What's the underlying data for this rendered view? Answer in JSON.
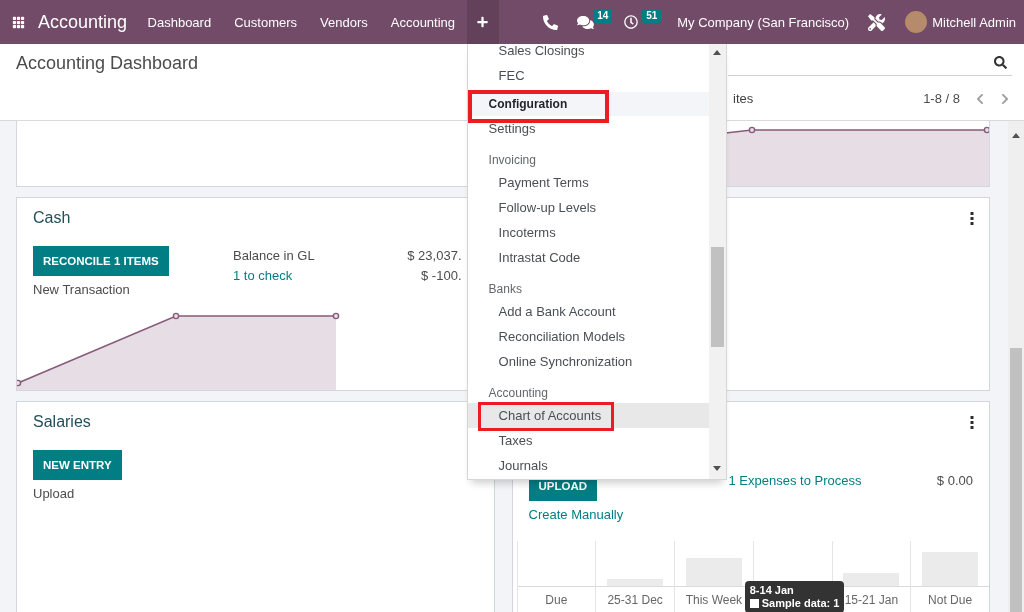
{
  "navbar": {
    "app_name": "Accounting",
    "menus": [
      {
        "label": "Dashboard"
      },
      {
        "label": "Customers"
      },
      {
        "label": "Vendors"
      },
      {
        "label": "Accounting"
      }
    ],
    "plus_menu": {
      "open": true,
      "entries": [
        {
          "kind": "item",
          "label": "Sales Closings",
          "highlighted": false,
          "annotated": false
        },
        {
          "kind": "item",
          "label": "FEC",
          "highlighted": false,
          "annotated": false
        },
        {
          "kind": "header",
          "label": "Configuration",
          "highlighted": true,
          "annotated": true
        },
        {
          "kind": "entry",
          "label": "Settings",
          "highlighted": false,
          "annotated": false
        },
        {
          "kind": "section",
          "label": "Invoicing",
          "highlighted": false,
          "annotated": false
        },
        {
          "kind": "item",
          "label": "Payment Terms",
          "highlighted": false,
          "annotated": false
        },
        {
          "kind": "item",
          "label": "Follow-up Levels",
          "highlighted": false,
          "annotated": false
        },
        {
          "kind": "item",
          "label": "Incoterms",
          "highlighted": false,
          "annotated": false
        },
        {
          "kind": "item",
          "label": "Intrastat Code",
          "highlighted": false,
          "annotated": false
        },
        {
          "kind": "section",
          "label": "Banks",
          "highlighted": false,
          "annotated": false
        },
        {
          "kind": "item",
          "label": "Add a Bank Account",
          "highlighted": false,
          "annotated": false
        },
        {
          "kind": "item",
          "label": "Reconciliation Models",
          "highlighted": false,
          "annotated": false
        },
        {
          "kind": "item",
          "label": "Online Synchronization",
          "highlighted": false,
          "annotated": false
        },
        {
          "kind": "section",
          "label": "Accounting",
          "highlighted": false,
          "annotated": false
        },
        {
          "kind": "item",
          "label": "Chart of Accounts",
          "highlighted": true,
          "annotated": true
        },
        {
          "kind": "item",
          "label": "Taxes",
          "highlighted": false,
          "annotated": false
        },
        {
          "kind": "item",
          "label": "Journals",
          "highlighted": false,
          "annotated": false
        }
      ]
    },
    "systray": {
      "messages_badge": "14",
      "activities_badge": "51",
      "company": "My Company (San Francisco)",
      "user": "Mitchell Admin"
    }
  },
  "control_panel": {
    "title": "Accounting Dashboard",
    "filter_label": "ites",
    "pager": "1-8 / 8"
  },
  "cards": [
    {
      "menu_icon": false
    },
    {
      "menu_icon": false,
      "graph": {
        "kind": "flat_area"
      }
    },
    {
      "title": "Cash",
      "menu_icon": false,
      "button": "RECONCILE 1 ITEMS",
      "action": {
        "label": "New Transaction",
        "kind": "text"
      },
      "lines": [
        {
          "label": "Balance in GL",
          "amount": "$ 23,037.",
          "kind": "text"
        },
        {
          "label": "1 to check",
          "amount": "$ -100.",
          "kind": "link"
        }
      ],
      "graph": {
        "kind": "rising_area"
      }
    },
    {
      "menu_icon": true
    },
    {
      "title": "Salaries",
      "menu_icon": false,
      "button": "NEW ENTRY",
      "action": {
        "label": "Upload",
        "kind": "text"
      }
    },
    {
      "menu_icon": true,
      "button": "UPLOAD",
      "action": {
        "label": "Create Manually",
        "kind": "link"
      },
      "lines": [
        {
          "label": "1 Expenses to Process",
          "amount": "$ 0.00",
          "kind": "link"
        }
      ],
      "graph": {
        "kind": "bars",
        "slots": [
          {
            "label": "Due"
          },
          {
            "label": "25-31 Dec"
          },
          {
            "label": "This Week"
          },
          {
            "tooltip": {
              "title": "8-14 Jan",
              "text": "Sample data: 1"
            }
          },
          {
            "label": "15-21 Jan"
          },
          {
            "label": "Not Due"
          }
        ]
      }
    }
  ]
}
